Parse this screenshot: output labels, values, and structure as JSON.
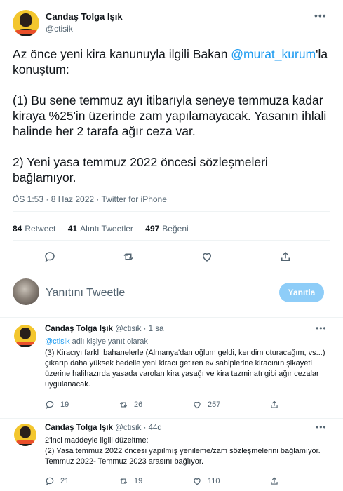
{
  "main_tweet": {
    "author_name": "Candaş Tolga Işık",
    "author_handle": "@ctisik",
    "text_before_mention": "Az önce yeni kira kanunuyla ilgili Bakan ",
    "mention": "@murat_kurum",
    "text_after_mention": "'la konuştum:\n\n(1) Bu sene temmuz ayı itibarıyla seneye temmuza kadar kiraya %25'in üzerinde zam yapılamayacak. Yasanın ihlali halinde her 2 tarafa ağır ceza var.\n\n2) Yeni yasa temmuz 2022 öncesi   sözleşmeleri bağlamıyor.",
    "meta": "ÖS 1:53 · 8 Haz 2022 · Twitter for iPhone",
    "stats": {
      "retweets_count": "84",
      "retweets_label": "Retweet",
      "quotes_count": "41",
      "quotes_label": "Alıntı Tweetler",
      "likes_count": "497",
      "likes_label": "Beğeni"
    }
  },
  "reply_box": {
    "placeholder": "Yanıtını Tweetle",
    "button_label": "Yanıtla"
  },
  "replies": [
    {
      "author_name": "Candaş Tolga Işık",
      "author_handle": "@ctisik",
      "time": "· 1 sa",
      "replying_mention": "@ctisik",
      "replying_suffix": " adlı kişiye yanıt olarak",
      "text": "(3) Kiracıyı farklı bahanelerle (Almanya'dan oğlum geldi, kendim oturacağım, vs...) çıkarıp daha yüksek bedelle yeni kiracı getiren ev sahiplerine kiracının şikayeti üzerine halihazırda yasada varolan kira yasağı ve kira tazminatı gibi ağır cezalar uygulanacak.",
      "replies": "19",
      "retweets": "26",
      "likes": "257"
    },
    {
      "author_name": "Candaş Tolga Işık",
      "author_handle": "@ctisik",
      "time": "· 44d",
      "text": "2'inci maddeyle ilgili düzeltme:\n(2) Yasa temmuz 2022 öncesi yapılmış yenileme/zam sözleşmelerini bağlamıyor. Temmuz 2022- Temmuz 2023 arasını bağlıyor.",
      "replies": "21",
      "retweets": "19",
      "likes": "110"
    }
  ],
  "icons": {
    "reply": "reply-icon",
    "retweet": "retweet-icon",
    "like": "heart-icon",
    "share": "share-icon",
    "more": "more-icon"
  },
  "colors": {
    "accent": "#1d9bf0",
    "secondary_text": "#536471",
    "reply_button_disabled": "#8ecdf8"
  }
}
